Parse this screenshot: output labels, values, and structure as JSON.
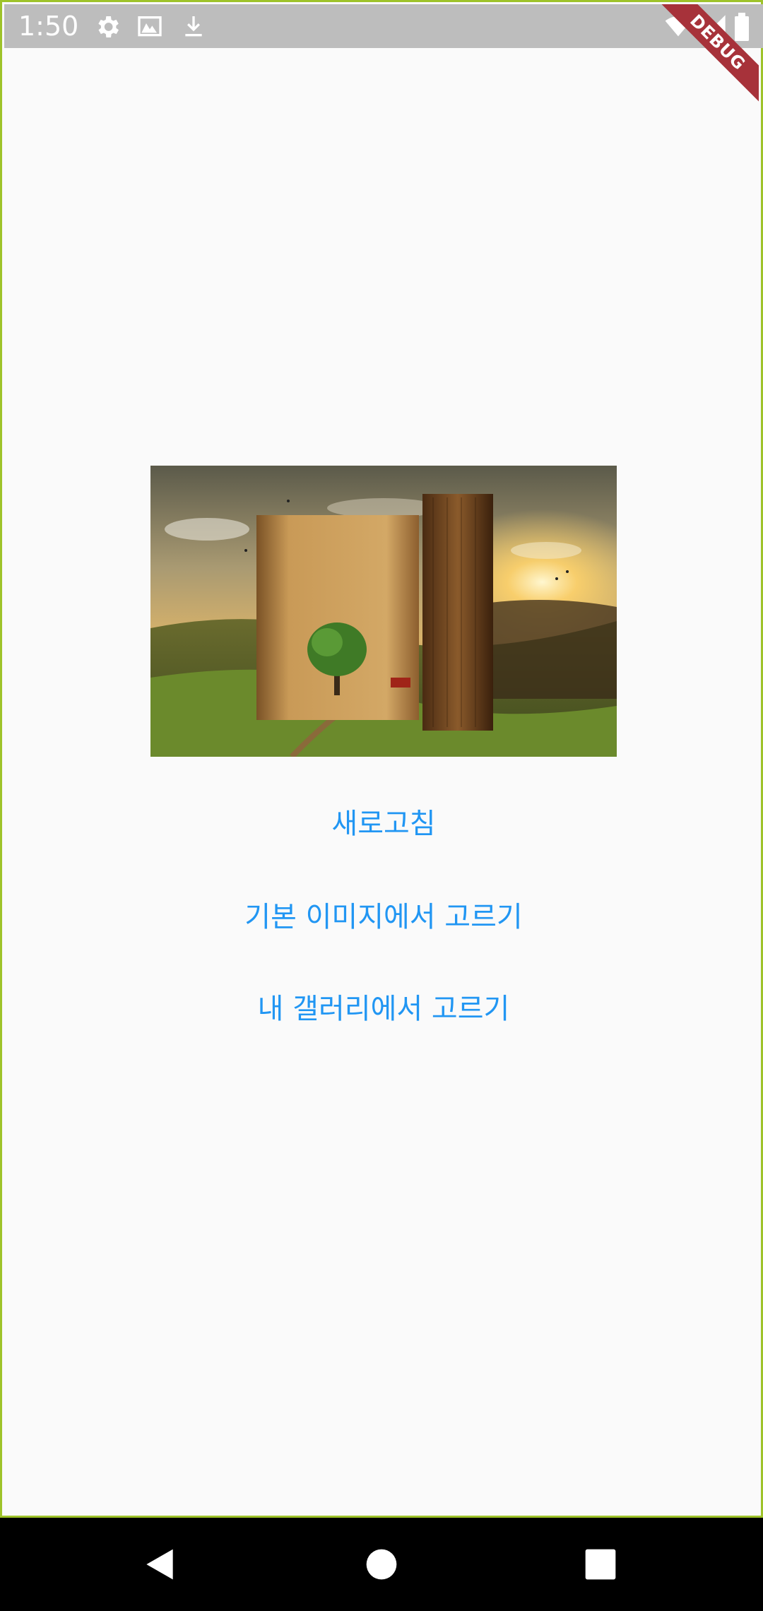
{
  "status_bar": {
    "time": "1:50",
    "icons": [
      "gear-icon",
      "photo-icon",
      "download-icon",
      "wifi-icon",
      "signal-icon",
      "battery-icon"
    ]
  },
  "debug_banner": {
    "label": "DEBUG"
  },
  "hero_image": {
    "description_icon": "book-landscape-image"
  },
  "actions": {
    "refresh_label": "새로고침",
    "pick_default_label": "기본 이미지에서 고르기",
    "pick_gallery_label": "내 갤러리에서 고르기"
  },
  "nav_bar": {
    "icons": [
      "back-icon",
      "home-icon",
      "recents-icon"
    ]
  },
  "colors": {
    "accent": "#2196f3",
    "frame": "#9ec32a",
    "status_bar": "#bdbdbd",
    "debug": "#a7323a"
  }
}
